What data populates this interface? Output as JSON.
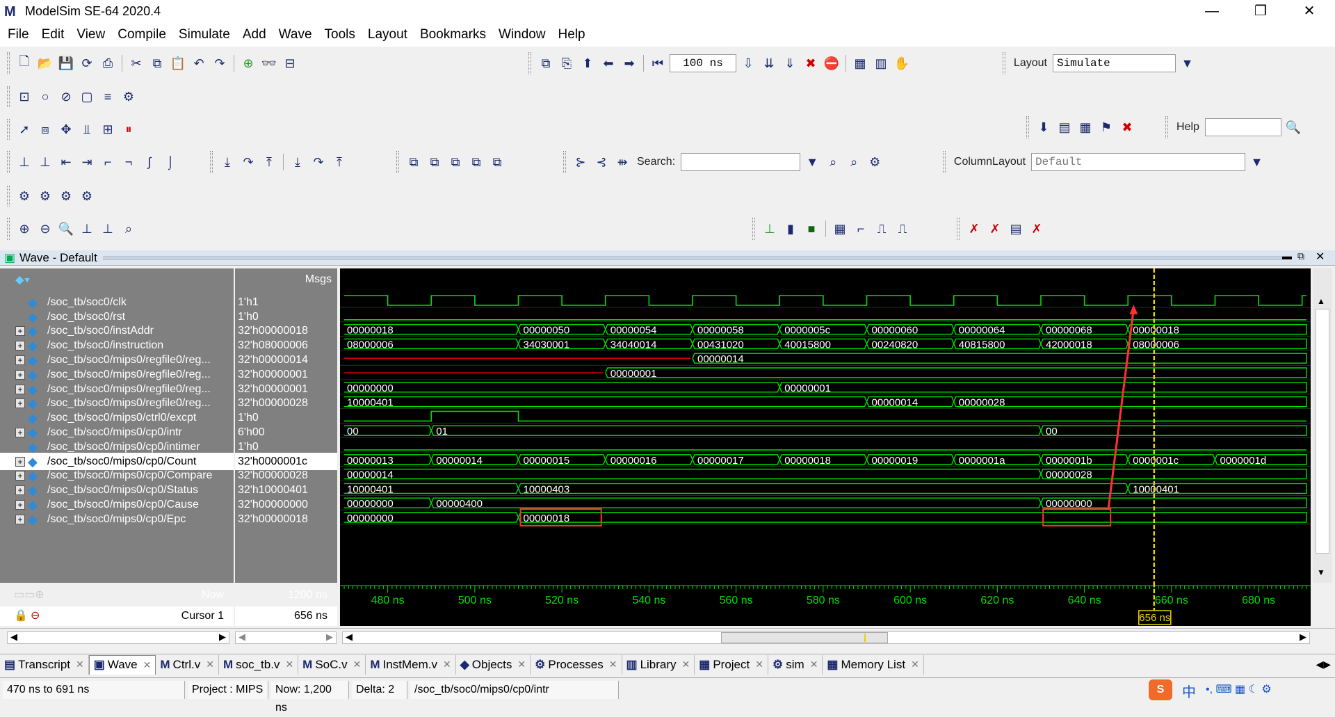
{
  "app": {
    "title": "ModelSim SE-64 2020.4",
    "logo": "M"
  },
  "menu": [
    "File",
    "Edit",
    "View",
    "Compile",
    "Simulate",
    "Add",
    "Wave",
    "Tools",
    "Layout",
    "Bookmarks",
    "Window",
    "Help"
  ],
  "toolbar": {
    "runlength_value": "100 ns",
    "layout_label": "Layout",
    "layout_value": "Simulate",
    "search_label": "Search:",
    "search_value": "",
    "column_layout_label": "ColumnLayout",
    "column_layout_value": "Default",
    "help_label": "Help",
    "help_value": ""
  },
  "wave_window": {
    "title": "Wave - Default",
    "msgs_header": "Msgs",
    "now_label": "Now",
    "now_value": "1200 ns",
    "cursor_label": "Cursor 1",
    "cursor_value": "656 ns",
    "cursor_marker": "656 ns"
  },
  "signals": [
    {
      "name": "/soc_tb/soc0/clk",
      "value": "1'h1",
      "type": "bit",
      "expandable": false
    },
    {
      "name": "/soc_tb/soc0/rst",
      "value": "1'h0",
      "type": "bit",
      "expandable": false
    },
    {
      "name": "/soc_tb/soc0/instAddr",
      "value": "32'h00000018",
      "type": "bus",
      "expandable": true
    },
    {
      "name": "/soc_tb/soc0/instruction",
      "value": "32'h08000006",
      "type": "bus",
      "expandable": true
    },
    {
      "name": "/soc_tb/soc0/mips0/regfile0/reg...",
      "value": "32'h00000014",
      "type": "bus",
      "expandable": true
    },
    {
      "name": "/soc_tb/soc0/mips0/regfile0/reg...",
      "value": "32'h00000001",
      "type": "bus",
      "expandable": true
    },
    {
      "name": "/soc_tb/soc0/mips0/regfile0/reg...",
      "value": "32'h00000001",
      "type": "bus",
      "expandable": true
    },
    {
      "name": "/soc_tb/soc0/mips0/regfile0/reg...",
      "value": "32'h00000028",
      "type": "bus",
      "expandable": true
    },
    {
      "name": "/soc_tb/soc0/mips0/ctrl0/excpt",
      "value": "1'h0",
      "type": "bit",
      "expandable": false
    },
    {
      "name": "/soc_tb/soc0/mips0/cp0/intr",
      "value": "6'h00",
      "type": "bus",
      "expandable": true
    },
    {
      "name": "/soc_tb/soc0/mips0/cp0/intimer",
      "value": "1'h0",
      "type": "bit",
      "expandable": false
    },
    {
      "name": "/soc_tb/soc0/mips0/cp0/Count",
      "value": "32'h0000001c",
      "type": "bus",
      "expandable": true,
      "selected": true
    },
    {
      "name": "/soc_tb/soc0/mips0/cp0/Compare",
      "value": "32'h00000028",
      "type": "bus",
      "expandable": true
    },
    {
      "name": "/soc_tb/soc0/mips0/cp0/Status",
      "value": "32'h10000401",
      "type": "bus",
      "expandable": true
    },
    {
      "name": "/soc_tb/soc0/mips0/cp0/Cause",
      "value": "32'h00000000",
      "type": "bus",
      "expandable": true
    },
    {
      "name": "/soc_tb/soc0/mips0/cp0/Epc",
      "value": "32'h00000018",
      "type": "bus",
      "expandable": true
    }
  ],
  "waveforms": {
    "time_range": [
      470,
      691
    ],
    "cursor_time": 656,
    "tick_labels": [
      "480 ns",
      "500 ns",
      "520 ns",
      "540 ns",
      "560 ns",
      "580 ns",
      "600 ns",
      "620 ns",
      "640 ns",
      "660 ns",
      "680 ns"
    ],
    "ticks": [
      480,
      500,
      520,
      540,
      560,
      580,
      600,
      620,
      640,
      660,
      680
    ],
    "rows": [
      {
        "kind": "clock",
        "period": 20,
        "high_start": 470
      },
      {
        "kind": "bit",
        "segments": [
          [
            470,
            691,
            0
          ]
        ]
      },
      {
        "kind": "bus",
        "segments": [
          [
            470,
            510,
            "00000018"
          ],
          [
            510,
            530,
            "00000050"
          ],
          [
            530,
            550,
            "00000054"
          ],
          [
            550,
            570,
            "00000058"
          ],
          [
            570,
            590,
            "0000005c"
          ],
          [
            590,
            610,
            "00000060"
          ],
          [
            610,
            630,
            "00000064"
          ],
          [
            630,
            650,
            "00000068"
          ],
          [
            650,
            691,
            "00000018"
          ]
        ]
      },
      {
        "kind": "bus",
        "segments": [
          [
            470,
            510,
            "08000006"
          ],
          [
            510,
            530,
            "34030001"
          ],
          [
            530,
            550,
            "34040014"
          ],
          [
            550,
            570,
            "00431020"
          ],
          [
            570,
            590,
            "40015800"
          ],
          [
            590,
            610,
            "00240820"
          ],
          [
            610,
            630,
            "40815800"
          ],
          [
            630,
            650,
            "42000018"
          ],
          [
            650,
            691,
            "08000006"
          ]
        ]
      },
      {
        "kind": "bus",
        "segments": [
          [
            470,
            550,
            "xxxxxxxx"
          ],
          [
            550,
            691,
            "00000014"
          ]
        ]
      },
      {
        "kind": "bus",
        "segments": [
          [
            470,
            530,
            "xxxxxxxx"
          ],
          [
            530,
            691,
            "00000001"
          ]
        ]
      },
      {
        "kind": "bus",
        "segments": [
          [
            470,
            570,
            "00000000"
          ],
          [
            570,
            691,
            "00000001"
          ]
        ]
      },
      {
        "kind": "bus",
        "segments": [
          [
            470,
            590,
            "10000401"
          ],
          [
            590,
            610,
            "00000014"
          ],
          [
            610,
            691,
            "00000028"
          ]
        ]
      },
      {
        "kind": "bit",
        "segments": [
          [
            470,
            490,
            0
          ],
          [
            490,
            510,
            1
          ],
          [
            510,
            691,
            0
          ]
        ]
      },
      {
        "kind": "bus",
        "segments": [
          [
            470,
            490,
            "00"
          ],
          [
            490,
            630,
            "01"
          ],
          [
            630,
            691,
            "00"
          ]
        ]
      },
      {
        "kind": "bit",
        "segments": [
          [
            470,
            691,
            0
          ]
        ]
      },
      {
        "kind": "bus",
        "segments": [
          [
            470,
            490,
            "00000013"
          ],
          [
            490,
            510,
            "00000014"
          ],
          [
            510,
            530,
            "00000015"
          ],
          [
            530,
            550,
            "00000016"
          ],
          [
            550,
            570,
            "00000017"
          ],
          [
            570,
            590,
            "00000018"
          ],
          [
            590,
            610,
            "00000019"
          ],
          [
            610,
            630,
            "0000001a"
          ],
          [
            630,
            650,
            "0000001b"
          ],
          [
            650,
            670,
            "0000001c"
          ],
          [
            670,
            691,
            "0000001d"
          ]
        ]
      },
      {
        "kind": "bus",
        "segments": [
          [
            470,
            630,
            "00000014"
          ],
          [
            630,
            691,
            "00000028"
          ]
        ]
      },
      {
        "kind": "bus",
        "segments": [
          [
            470,
            510,
            "10000401"
          ],
          [
            510,
            650,
            "10000403"
          ],
          [
            650,
            691,
            "10000401"
          ]
        ]
      },
      {
        "kind": "bus",
        "segments": [
          [
            470,
            490,
            "00000000"
          ],
          [
            490,
            630,
            "00000400"
          ],
          [
            630,
            691,
            "00000000"
          ]
        ]
      },
      {
        "kind": "bus",
        "segments": [
          [
            470,
            510,
            "00000000"
          ],
          [
            510,
            691,
            "00000018"
          ]
        ]
      }
    ]
  },
  "colors": {
    "wave_green": "#00e000",
    "undefined_red": "#d00000",
    "cursor_yellow": "#e8d200",
    "annotation_red": "#ff3030",
    "selected_row": "#ffffff"
  },
  "tabs": [
    {
      "label": "Transcript",
      "icon": "transcript-icon",
      "closable": true
    },
    {
      "label": "Wave",
      "icon": "wave-icon",
      "closable": true,
      "active": true
    },
    {
      "label": "Ctrl.v",
      "icon": "verilog-file-icon",
      "closable": true
    },
    {
      "label": "soc_tb.v",
      "icon": "verilog-file-icon",
      "closable": true
    },
    {
      "label": "SoC.v",
      "icon": "verilog-file-icon",
      "closable": true
    },
    {
      "label": "InstMem.v",
      "icon": "verilog-file-icon",
      "closable": true
    },
    {
      "label": "Objects",
      "icon": "objects-icon",
      "closable": true
    },
    {
      "label": "Processes",
      "icon": "gear-icon",
      "closable": true
    },
    {
      "label": "Library",
      "icon": "library-icon",
      "closable": true
    },
    {
      "label": "Project",
      "icon": "project-icon",
      "closable": true
    },
    {
      "label": "sim",
      "icon": "sim-icon",
      "closable": true
    },
    {
      "label": "Memory List",
      "icon": "memory-icon",
      "closable": true
    }
  ],
  "status": {
    "range": "470 ns to 691 ns",
    "project": "Project : MIPS",
    "now": "Now: 1,200 ns",
    "delta": "Delta: 2",
    "path": "/soc_tb/soc0/mips0/cp0/intr",
    "ime": "中"
  }
}
